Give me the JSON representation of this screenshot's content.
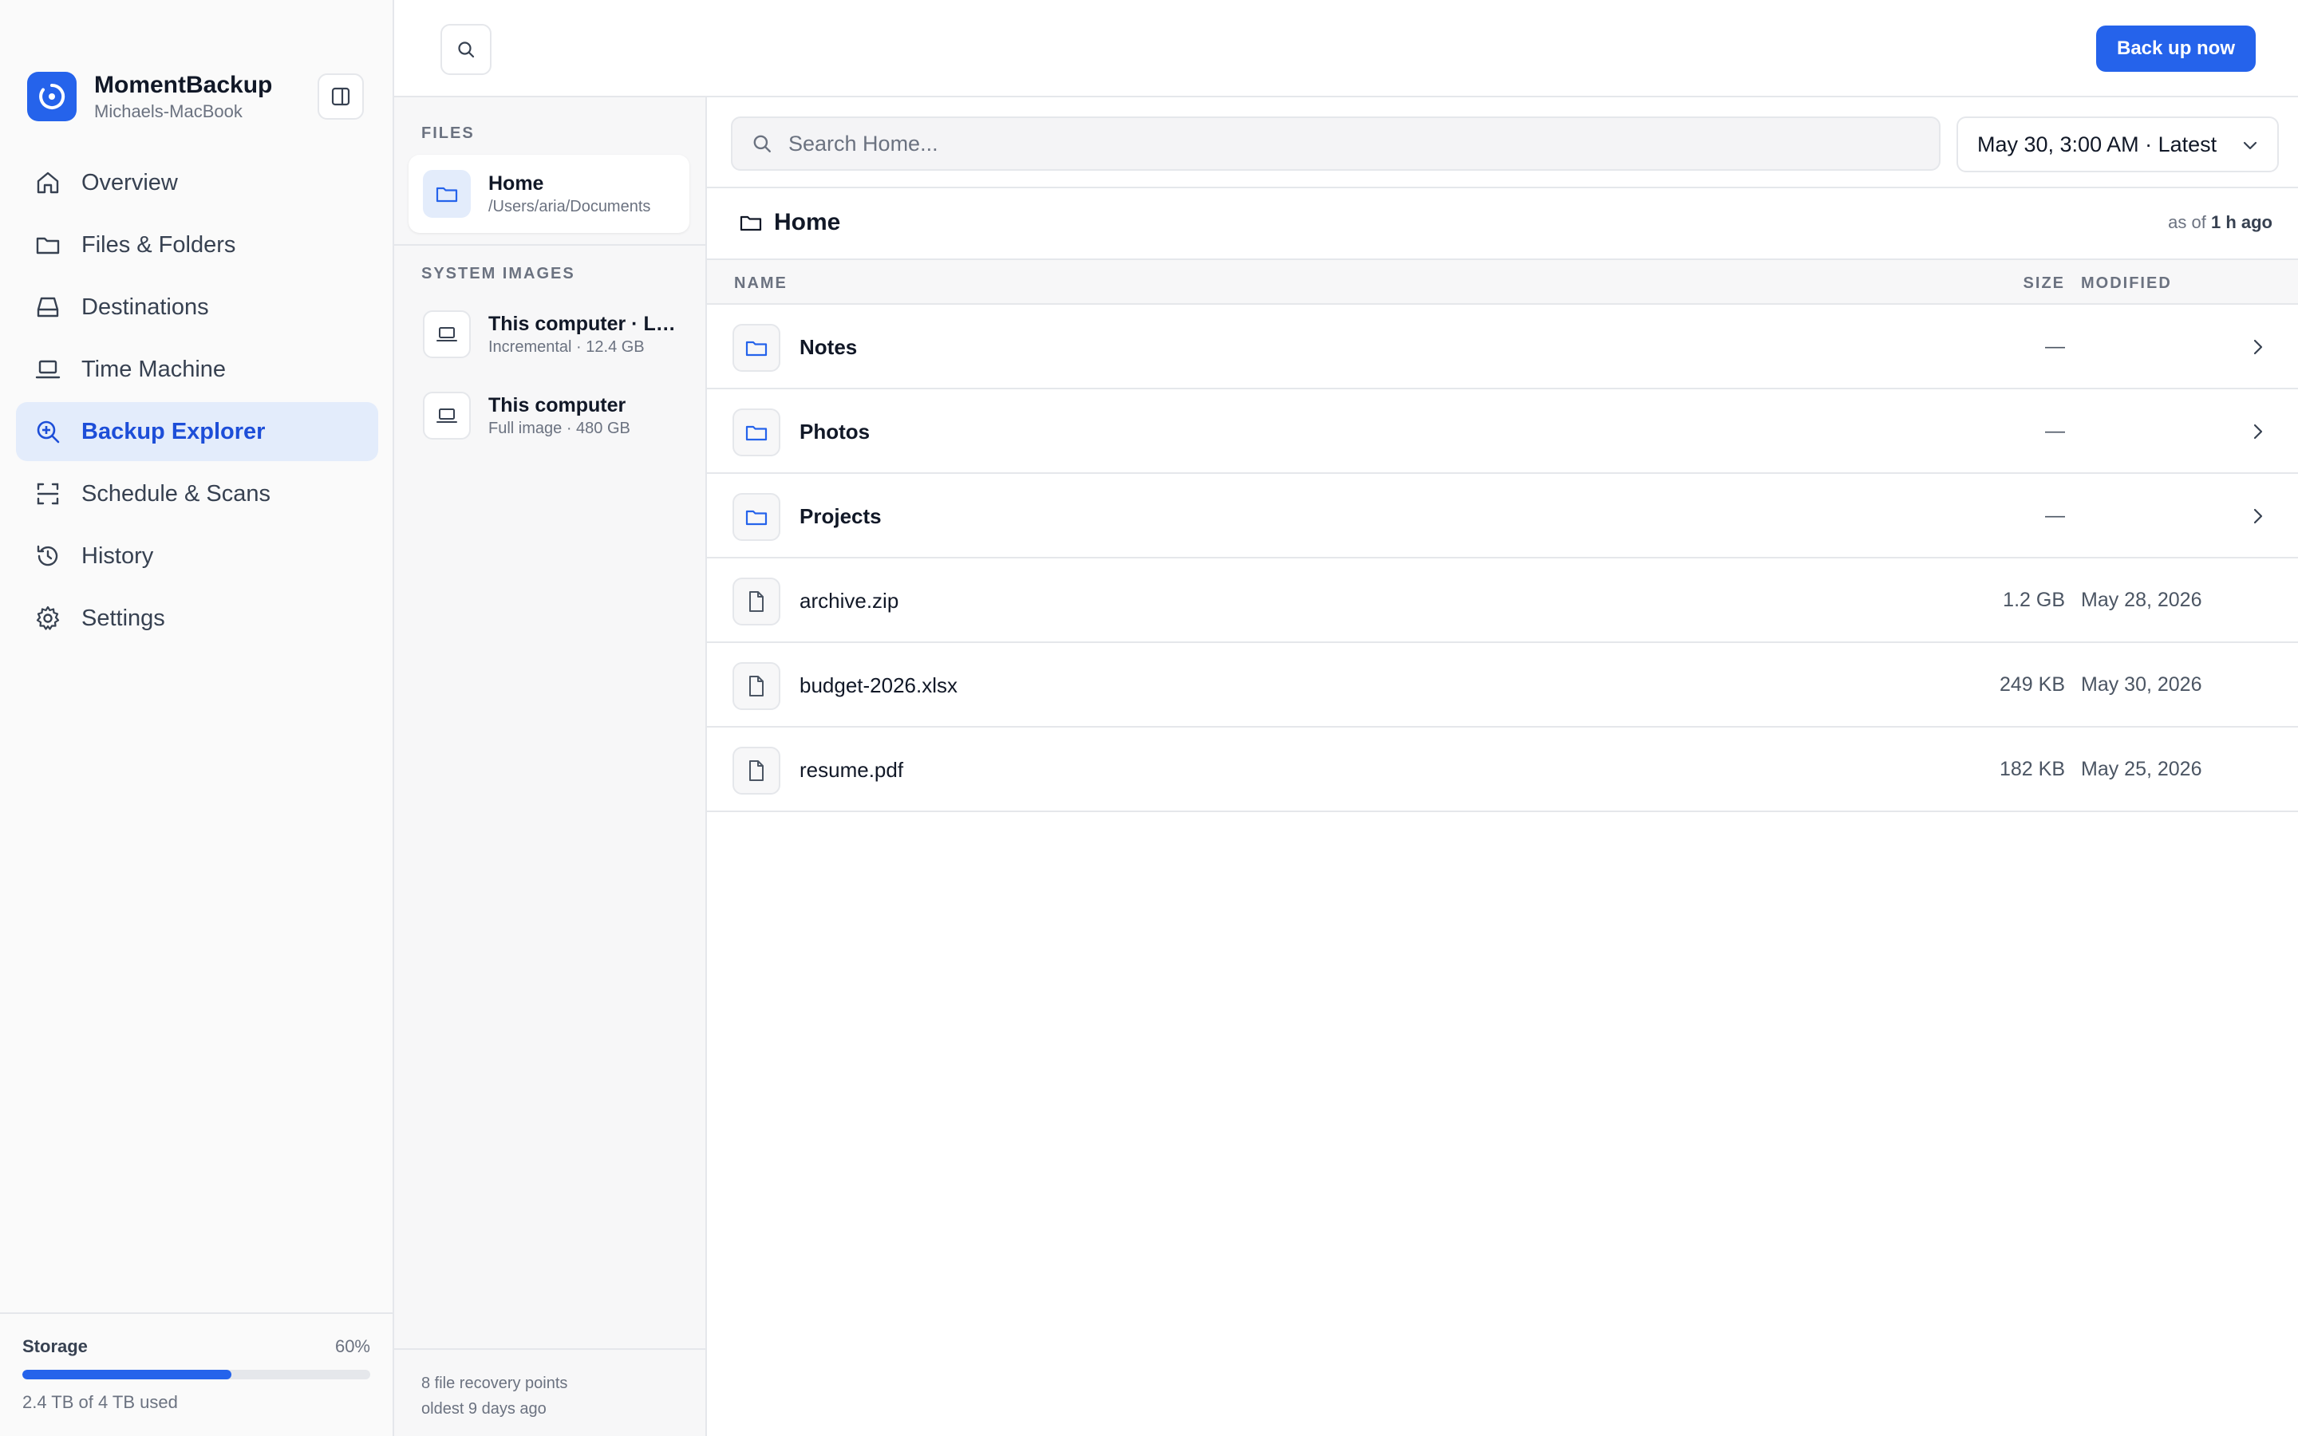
{
  "app": {
    "name": "MomentBackup",
    "device": "Michaels-MacBook"
  },
  "sidebar": {
    "items": [
      {
        "label": "Overview",
        "icon": "home-icon"
      },
      {
        "label": "Files & Folders",
        "icon": "folder-icon"
      },
      {
        "label": "Destinations",
        "icon": "drive-icon"
      },
      {
        "label": "Time Machine",
        "icon": "laptop-icon"
      },
      {
        "label": "Backup Explorer",
        "icon": "search-zoom-icon",
        "active": true
      },
      {
        "label": "Schedule & Scans",
        "icon": "scan-icon"
      },
      {
        "label": "History",
        "icon": "history-icon"
      },
      {
        "label": "Settings",
        "icon": "gear-icon"
      }
    ],
    "storage": {
      "label": "Storage",
      "percent_label": "60%",
      "fraction": 0.6,
      "used_label": "2.4 TB of 4 TB used"
    }
  },
  "topbar": {
    "backup_label": "Back up now"
  },
  "panel": {
    "files_heading": "FILES",
    "files": [
      {
        "title": "Home",
        "subtitle": "/Users/aria/Documents"
      }
    ],
    "system_heading": "SYSTEM IMAGES",
    "system_images": [
      {
        "title": "This computer · La...",
        "subtitle": "Incremental · 12.4 GB"
      },
      {
        "title": "This computer",
        "subtitle": "Full image · 480 GB"
      }
    ],
    "footer_line1": "8 file recovery points",
    "footer_line2": "oldest 9 days ago"
  },
  "main": {
    "search_placeholder": "Search Home...",
    "recovery_point": "May 30, 3:00 AM · Latest",
    "crumb": "Home",
    "asof_prefix": "as of",
    "asof_value": "1 h ago",
    "columns": {
      "name": "NAME",
      "size": "SIZE",
      "modified": "MODIFIED"
    },
    "rows": [
      {
        "name": "Notes",
        "type": "folder",
        "size": "—",
        "modified": ""
      },
      {
        "name": "Photos",
        "type": "folder",
        "size": "—",
        "modified": ""
      },
      {
        "name": "Projects",
        "type": "folder",
        "size": "—",
        "modified": ""
      },
      {
        "name": "archive.zip",
        "type": "file",
        "size": "1.2 GB",
        "modified": "May 28, 2026"
      },
      {
        "name": "budget-2026.xlsx",
        "type": "file",
        "size": "249 KB",
        "modified": "May 30, 2026"
      },
      {
        "name": "resume.pdf",
        "type": "file",
        "size": "182 KB",
        "modified": "May 25, 2026"
      }
    ]
  },
  "colors": {
    "accent": "#2563eb",
    "active_bg": "#e3ecfb",
    "border": "#e5e7eb"
  }
}
